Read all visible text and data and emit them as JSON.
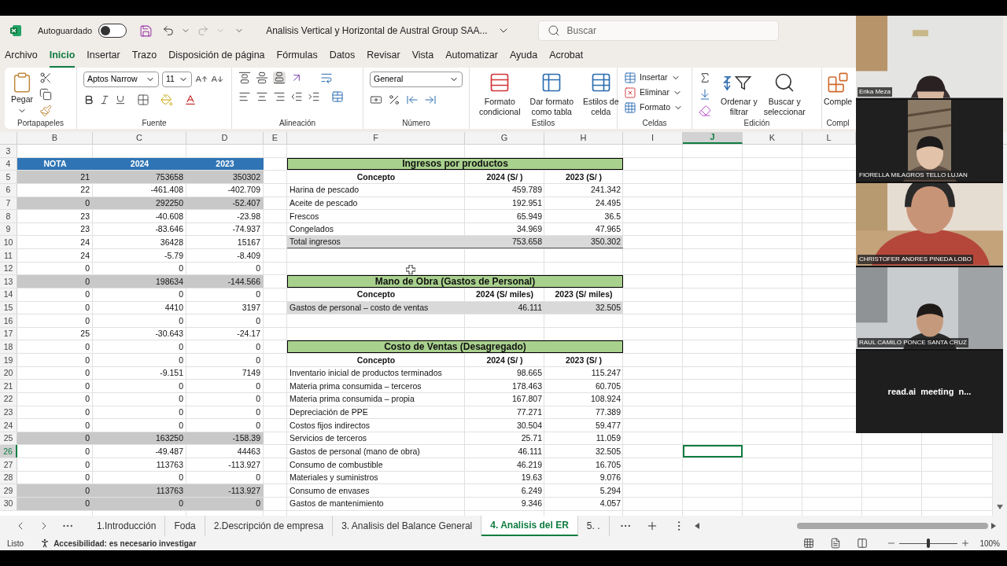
{
  "title_bar": {
    "autosave": {
      "label": "Autoguardado",
      "on": false
    },
    "document_title": "Analisis Vertical y Horizontal de Austral Group SAA...",
    "search_placeholder": "Buscar"
  },
  "menu_tabs": [
    {
      "label": "Archivo",
      "selected": false
    },
    {
      "label": "Inicio",
      "selected": true
    },
    {
      "label": "Insertar",
      "selected": false
    },
    {
      "label": "Trazo",
      "selected": false
    },
    {
      "label": "Disposición de página",
      "selected": false
    },
    {
      "label": "Fórmulas",
      "selected": false
    },
    {
      "label": "Datos",
      "selected": false
    },
    {
      "label": "Revisar",
      "selected": false
    },
    {
      "label": "Vista",
      "selected": false
    },
    {
      "label": "Automatizar",
      "selected": false
    },
    {
      "label": "Ayuda",
      "selected": false
    },
    {
      "label": "Acrobat",
      "selected": false
    }
  ],
  "ribbon": {
    "clipboard": {
      "paste": "Pegar",
      "label": "Portapapeles"
    },
    "font": {
      "font_name": "Aptos Narrow",
      "font_size": "11",
      "label": "Fuente"
    },
    "alignment": {
      "label": "Alineación"
    },
    "number": {
      "format": "General",
      "label": "Número"
    },
    "styles": {
      "buttons": [
        [
          "Formato",
          "condicional"
        ],
        [
          "Dar formato",
          "como tabla"
        ],
        [
          "Estilos de",
          "celda"
        ]
      ],
      "label": "Estilos"
    },
    "cells": {
      "buttons": [
        "Insertar",
        "Eliminar",
        "Formato"
      ],
      "label": "Celdas"
    },
    "editing": {
      "buttons": [
        [
          "Ordenar y",
          "filtrar"
        ],
        [
          "Buscar y",
          "seleccionar"
        ]
      ],
      "label": "Edición"
    },
    "addins": {
      "button": "Comple",
      "label": "Compl"
    }
  },
  "columns": [
    {
      "label": "B",
      "selected": false
    },
    {
      "label": "C",
      "selected": false
    },
    {
      "label": "D",
      "selected": false
    },
    {
      "label": "E",
      "selected": false
    },
    {
      "label": "F",
      "selected": false
    },
    {
      "label": "G",
      "selected": false
    },
    {
      "label": "H",
      "selected": false
    },
    {
      "label": "I",
      "selected": false
    },
    {
      "label": "J",
      "selected": true
    },
    {
      "label": "K",
      "selected": false
    },
    {
      "label": "L",
      "selected": false
    }
  ],
  "rows": [
    {
      "number": "3",
      "active": false
    },
    {
      "number": "4",
      "active": false,
      "left": {
        "kind": "header",
        "cells": [
          "NOTA",
          "2024",
          "2023"
        ]
      },
      "right": {
        "kind": "title",
        "text": "Ingresos por productos"
      }
    },
    {
      "number": "5",
      "active": false,
      "left": {
        "kind": "shaded",
        "cells": [
          "21",
          "753658",
          "350302"
        ]
      },
      "right": {
        "kind": "header",
        "cells": [
          "Concepto",
          "2024 (S/ )",
          "2023 (S/ )"
        ]
      }
    },
    {
      "number": "6",
      "active": false,
      "left": {
        "kind": "plain",
        "cells": [
          "22",
          "-461.408",
          "-402.709"
        ]
      },
      "right": {
        "kind": "item",
        "cells": [
          "Harina de pescado",
          "459.789",
          "241.342"
        ]
      }
    },
    {
      "number": "7",
      "active": false,
      "left": {
        "kind": "shaded",
        "cells": [
          "0",
          "292250",
          "-52.407"
        ]
      },
      "right": {
        "kind": "item",
        "cells": [
          "Aceite de pescado",
          "192.951",
          "24.495"
        ]
      }
    },
    {
      "number": "8",
      "active": false,
      "left": {
        "kind": "plain",
        "cells": [
          "23",
          "-40.608",
          "-23.98"
        ]
      },
      "right": {
        "kind": "item",
        "cells": [
          "Frescos",
          "65.949",
          "36.5"
        ]
      }
    },
    {
      "number": "9",
      "active": false,
      "left": {
        "kind": "plain",
        "cells": [
          "23",
          "-83.646",
          "-74.937"
        ]
      },
      "right": {
        "kind": "item",
        "cells": [
          "Congelados",
          "34.969",
          "47.965"
        ]
      }
    },
    {
      "number": "10",
      "active": false,
      "left": {
        "kind": "plain",
        "cells": [
          "24",
          "36428",
          "15167"
        ]
      },
      "right": {
        "kind": "total",
        "cells": [
          "Total ingresos",
          "753.658",
          "350.302"
        ]
      }
    },
    {
      "number": "11",
      "active": false,
      "left": {
        "kind": "plain",
        "cells": [
          "24",
          "-5.79",
          "-8.409"
        ]
      }
    },
    {
      "number": "12",
      "active": false,
      "left": {
        "kind": "plain",
        "cells": [
          "0",
          "0",
          "0"
        ]
      }
    },
    {
      "number": "13",
      "active": false,
      "left": {
        "kind": "shaded",
        "cells": [
          "0",
          "198634",
          "-144.566"
        ]
      },
      "right": {
        "kind": "title",
        "text": "Mano de Obra (Gastos de Personal)"
      }
    },
    {
      "number": "14",
      "active": false,
      "left": {
        "kind": "plain",
        "cells": [
          "0",
          "0",
          "0"
        ]
      },
      "right": {
        "kind": "header",
        "cells": [
          "Concepto",
          "2024 (S/ miles)",
          "2023 (S/ miles)"
        ]
      }
    },
    {
      "number": "15",
      "active": false,
      "left": {
        "kind": "plain",
        "cells": [
          "0",
          "4410",
          "3197"
        ]
      },
      "right": {
        "kind": "shaded",
        "cells": [
          "Gastos de personal – costo de ventas",
          "46.111",
          "32.505"
        ]
      }
    },
    {
      "number": "16",
      "active": false,
      "left": {
        "kind": "plain",
        "cells": [
          "0",
          "0",
          "0"
        ]
      }
    },
    {
      "number": "17",
      "active": false,
      "left": {
        "kind": "plain",
        "cells": [
          "25",
          "-30.643",
          "-24.17"
        ]
      }
    },
    {
      "number": "18",
      "active": false,
      "left": {
        "kind": "plain",
        "cells": [
          "0",
          "0",
          "0"
        ]
      },
      "right": {
        "kind": "title",
        "text": "Costo de Ventas (Desagregado)"
      }
    },
    {
      "number": "19",
      "active": false,
      "left": {
        "kind": "plain",
        "cells": [
          "0",
          "0",
          "0"
        ]
      },
      "right": {
        "kind": "header",
        "cells": [
          "Concepto",
          "2024 (S/ )",
          "2023 (S/ )"
        ]
      }
    },
    {
      "number": "20",
      "active": false,
      "left": {
        "kind": "plain",
        "cells": [
          "0",
          "-9.151",
          "7149"
        ]
      },
      "right": {
        "kind": "item",
        "cells": [
          "Inventario inicial de productos terminados",
          "98.665",
          "115.247"
        ]
      }
    },
    {
      "number": "21",
      "active": false,
      "left": {
        "kind": "plain",
        "cells": [
          "0",
          "0",
          "0"
        ]
      },
      "right": {
        "kind": "item",
        "cells": [
          "Materia prima consumida – terceros",
          "178.463",
          "60.705"
        ]
      }
    },
    {
      "number": "22",
      "active": false,
      "left": {
        "kind": "plain",
        "cells": [
          "0",
          "0",
          "0"
        ]
      },
      "right": {
        "kind": "item",
        "cells": [
          "Materia prima consumida – propia",
          "167.807",
          "108.924"
        ]
      }
    },
    {
      "number": "23",
      "active": false,
      "left": {
        "kind": "plain",
        "cells": [
          "0",
          "0",
          "0"
        ]
      },
      "right": {
        "kind": "item",
        "cells": [
          "Depreciación de PPE",
          "77.271",
          "77.389"
        ]
      }
    },
    {
      "number": "24",
      "active": false,
      "left": {
        "kind": "plain",
        "cells": [
          "0",
          "0",
          "0"
        ]
      },
      "right": {
        "kind": "item",
        "cells": [
          "Costos fijos indirectos",
          "30.504",
          "59.477"
        ]
      }
    },
    {
      "number": "25",
      "active": false,
      "left": {
        "kind": "shaded",
        "cells": [
          "0",
          "163250",
          "-158.39"
        ]
      },
      "right": {
        "kind": "item",
        "cells": [
          "Servicios de terceros",
          "25.71",
          "11.059"
        ]
      }
    },
    {
      "number": "26",
      "active": true,
      "left": {
        "kind": "plain",
        "cells": [
          "0",
          "-49.487",
          "44463"
        ]
      },
      "right": {
        "kind": "item",
        "cells": [
          "Gastos de personal (mano de obra)",
          "46.111",
          "32.505"
        ]
      }
    },
    {
      "number": "27",
      "active": false,
      "left": {
        "kind": "plain",
        "cells": [
          "0",
          "113763",
          "-113.927"
        ]
      },
      "right": {
        "kind": "item",
        "cells": [
          "Consumo de combustible",
          "46.219",
          "16.705"
        ]
      }
    },
    {
      "number": "28",
      "active": false,
      "left": {
        "kind": "plain",
        "cells": [
          "0",
          "0",
          "0"
        ]
      },
      "right": {
        "kind": "item",
        "cells": [
          "Materiales y suministros",
          "19.63",
          "9.076"
        ]
      }
    },
    {
      "number": "29",
      "active": false,
      "left": {
        "kind": "shaded",
        "cells": [
          "0",
          "113763",
          "-113.927"
        ]
      },
      "right": {
        "kind": "item",
        "cells": [
          "Consumo de envases",
          "6.249",
          "5.294"
        ]
      }
    },
    {
      "number": "30",
      "active": false,
      "left": {
        "kind": "shaded",
        "cells": [
          "0",
          "0",
          "0"
        ]
      },
      "right": {
        "kind": "item",
        "cells": [
          "Gastos de mantenimiento",
          "9.346",
          "4.057"
        ]
      }
    }
  ],
  "sheet_tabs": [
    {
      "label": "1.Introducción",
      "selected": false
    },
    {
      "label": "Foda",
      "selected": false
    },
    {
      "label": "2.Descripción de empresa",
      "selected": false
    },
    {
      "label": "3. Analisis del Balance General",
      "selected": false
    },
    {
      "label": "4. Analisis del ER",
      "selected": true
    },
    {
      "label": "5. .",
      "selected": false
    }
  ],
  "status_bar": {
    "status": "Listo",
    "accessibility": "Accesibilidad: es necesario investigar",
    "zoom": {
      "level": 0.49,
      "reading": "100%"
    }
  },
  "video_tiles": [
    {
      "kind": "camera",
      "name": "Erika Meza"
    },
    {
      "kind": "camera",
      "name": "FIORELLA MILAGROS TELLO LUJAN"
    },
    {
      "kind": "camera",
      "name": "CHRISTOFER ANDRES PINEDA LOBO"
    },
    {
      "kind": "camera",
      "name": "RAUL CAMILO PONCE SANTA CRUZ"
    },
    {
      "kind": "text",
      "caption": "read.ai  meeting  n..."
    }
  ]
}
